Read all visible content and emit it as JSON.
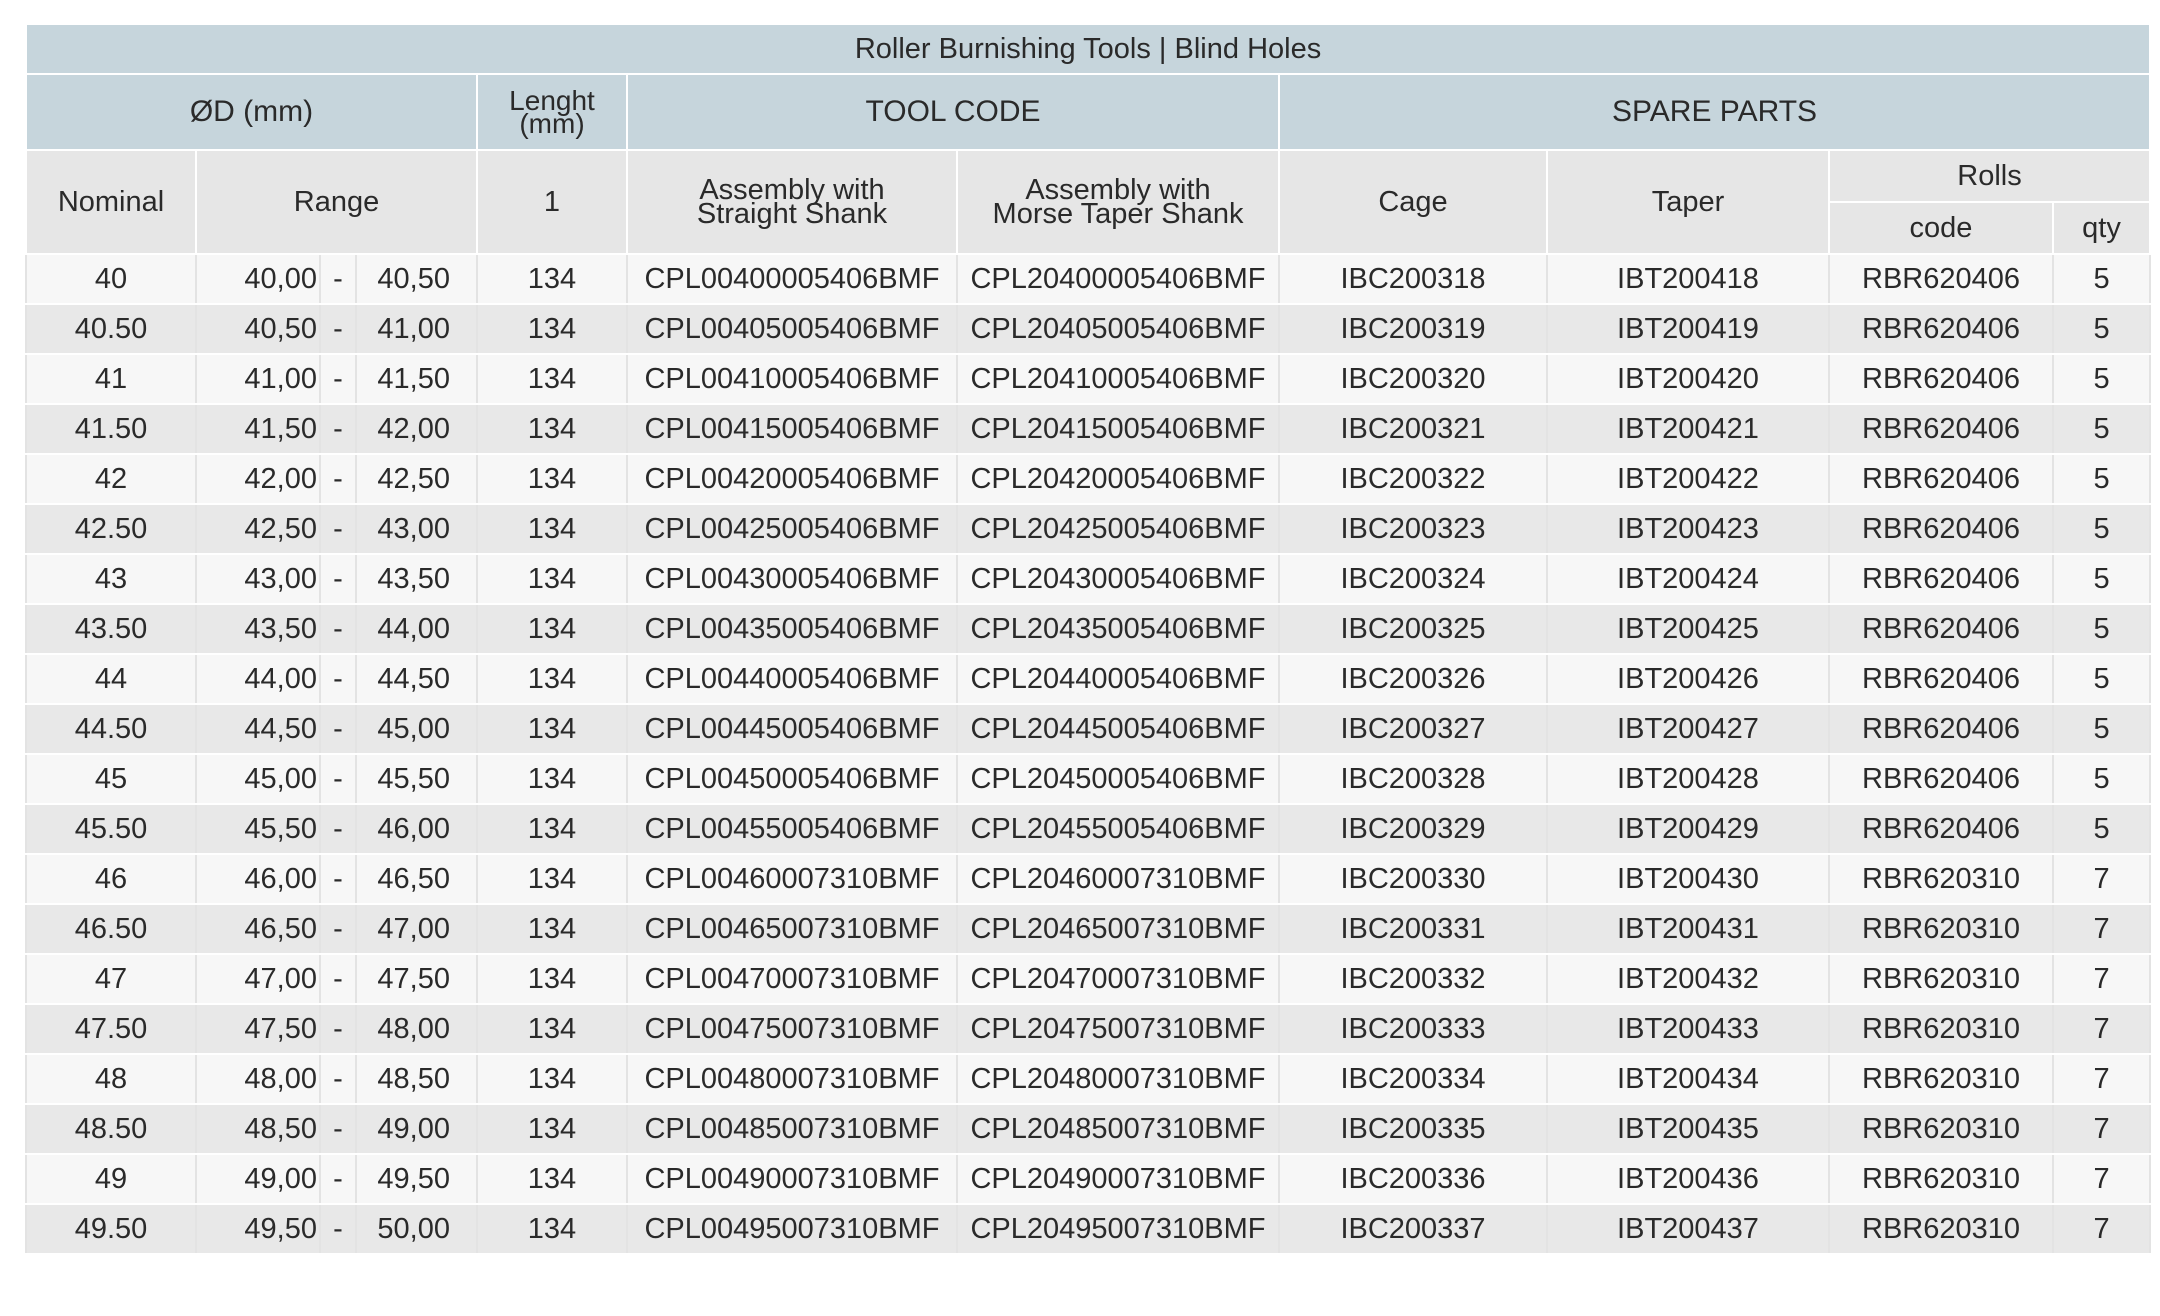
{
  "title": "Roller Burnishing Tools | Blind Holes",
  "header": {
    "diameter": "ØD (mm)",
    "length_line1": "Lenght",
    "length_line2": "(mm)",
    "tool_code": "TOOL CODE",
    "spare_parts": "SPARE PARTS",
    "nominal": "Nominal",
    "range": "Range",
    "length_value": "1",
    "straight_line1": "Assembly with",
    "straight_line2": "Straight Shank",
    "morse_line1": "Assembly with",
    "morse_line2": "Morse Taper Shank",
    "cage": "Cage",
    "taper": "Taper",
    "rolls": "Rolls",
    "rolls_code": "code",
    "rolls_qty": "qty"
  },
  "rows": [
    {
      "nominal": "40",
      "range_min": "40,00",
      "dash": "-",
      "range_max": "40,50",
      "length": "134",
      "straight": "CPL00400005406BMF",
      "morse": "CPL20400005406BMF",
      "cage": "IBC200318",
      "taper": "IBT200418",
      "roll_code": "RBR620406",
      "roll_qty": "5"
    },
    {
      "nominal": "40.50",
      "range_min": "40,50",
      "dash": "-",
      "range_max": "41,00",
      "length": "134",
      "straight": "CPL00405005406BMF",
      "morse": "CPL20405005406BMF",
      "cage": "IBC200319",
      "taper": "IBT200419",
      "roll_code": "RBR620406",
      "roll_qty": "5"
    },
    {
      "nominal": "41",
      "range_min": "41,00",
      "dash": "-",
      "range_max": "41,50",
      "length": "134",
      "straight": "CPL00410005406BMF",
      "morse": "CPL20410005406BMF",
      "cage": "IBC200320",
      "taper": "IBT200420",
      "roll_code": "RBR620406",
      "roll_qty": "5"
    },
    {
      "nominal": "41.50",
      "range_min": "41,50",
      "dash": "-",
      "range_max": "42,00",
      "length": "134",
      "straight": "CPL00415005406BMF",
      "morse": "CPL20415005406BMF",
      "cage": "IBC200321",
      "taper": "IBT200421",
      "roll_code": "RBR620406",
      "roll_qty": "5"
    },
    {
      "nominal": "42",
      "range_min": "42,00",
      "dash": "-",
      "range_max": "42,50",
      "length": "134",
      "straight": "CPL00420005406BMF",
      "morse": "CPL20420005406BMF",
      "cage": "IBC200322",
      "taper": "IBT200422",
      "roll_code": "RBR620406",
      "roll_qty": "5"
    },
    {
      "nominal": "42.50",
      "range_min": "42,50",
      "dash": "-",
      "range_max": "43,00",
      "length": "134",
      "straight": "CPL00425005406BMF",
      "morse": "CPL20425005406BMF",
      "cage": "IBC200323",
      "taper": "IBT200423",
      "roll_code": "RBR620406",
      "roll_qty": "5"
    },
    {
      "nominal": "43",
      "range_min": "43,00",
      "dash": "-",
      "range_max": "43,50",
      "length": "134",
      "straight": "CPL00430005406BMF",
      "morse": "CPL20430005406BMF",
      "cage": "IBC200324",
      "taper": "IBT200424",
      "roll_code": "RBR620406",
      "roll_qty": "5"
    },
    {
      "nominal": "43.50",
      "range_min": "43,50",
      "dash": "-",
      "range_max": "44,00",
      "length": "134",
      "straight": "CPL00435005406BMF",
      "morse": "CPL20435005406BMF",
      "cage": "IBC200325",
      "taper": "IBT200425",
      "roll_code": "RBR620406",
      "roll_qty": "5"
    },
    {
      "nominal": "44",
      "range_min": "44,00",
      "dash": "-",
      "range_max": "44,50",
      "length": "134",
      "straight": "CPL00440005406BMF",
      "morse": "CPL20440005406BMF",
      "cage": "IBC200326",
      "taper": "IBT200426",
      "roll_code": "RBR620406",
      "roll_qty": "5"
    },
    {
      "nominal": "44.50",
      "range_min": "44,50",
      "dash": "-",
      "range_max": "45,00",
      "length": "134",
      "straight": "CPL00445005406BMF",
      "morse": "CPL20445005406BMF",
      "cage": "IBC200327",
      "taper": "IBT200427",
      "roll_code": "RBR620406",
      "roll_qty": "5"
    },
    {
      "nominal": "45",
      "range_min": "45,00",
      "dash": "-",
      "range_max": "45,50",
      "length": "134",
      "straight": "CPL00450005406BMF",
      "morse": "CPL20450005406BMF",
      "cage": "IBC200328",
      "taper": "IBT200428",
      "roll_code": "RBR620406",
      "roll_qty": "5"
    },
    {
      "nominal": "45.50",
      "range_min": "45,50",
      "dash": "-",
      "range_max": "46,00",
      "length": "134",
      "straight": "CPL00455005406BMF",
      "morse": "CPL20455005406BMF",
      "cage": "IBC200329",
      "taper": "IBT200429",
      "roll_code": "RBR620406",
      "roll_qty": "5"
    },
    {
      "nominal": "46",
      "range_min": "46,00",
      "dash": "-",
      "range_max": "46,50",
      "length": "134",
      "straight": "CPL00460007310BMF",
      "morse": "CPL20460007310BMF",
      "cage": "IBC200330",
      "taper": "IBT200430",
      "roll_code": "RBR620310",
      "roll_qty": "7"
    },
    {
      "nominal": "46.50",
      "range_min": "46,50",
      "dash": "-",
      "range_max": "47,00",
      "length": "134",
      "straight": "CPL00465007310BMF",
      "morse": "CPL20465007310BMF",
      "cage": "IBC200331",
      "taper": "IBT200431",
      "roll_code": "RBR620310",
      "roll_qty": "7"
    },
    {
      "nominal": "47",
      "range_min": "47,00",
      "dash": "-",
      "range_max": "47,50",
      "length": "134",
      "straight": "CPL00470007310BMF",
      "morse": "CPL20470007310BMF",
      "cage": "IBC200332",
      "taper": "IBT200432",
      "roll_code": "RBR620310",
      "roll_qty": "7"
    },
    {
      "nominal": "47.50",
      "range_min": "47,50",
      "dash": "-",
      "range_max": "48,00",
      "length": "134",
      "straight": "CPL00475007310BMF",
      "morse": "CPL20475007310BMF",
      "cage": "IBC200333",
      "taper": "IBT200433",
      "roll_code": "RBR620310",
      "roll_qty": "7"
    },
    {
      "nominal": "48",
      "range_min": "48,00",
      "dash": "-",
      "range_max": "48,50",
      "length": "134",
      "straight": "CPL00480007310BMF",
      "morse": "CPL20480007310BMF",
      "cage": "IBC200334",
      "taper": "IBT200434",
      "roll_code": "RBR620310",
      "roll_qty": "7"
    },
    {
      "nominal": "48.50",
      "range_min": "48,50",
      "dash": "-",
      "range_max": "49,00",
      "length": "134",
      "straight": "CPL00485007310BMF",
      "morse": "CPL20485007310BMF",
      "cage": "IBC200335",
      "taper": "IBT200435",
      "roll_code": "RBR620310",
      "roll_qty": "7"
    },
    {
      "nominal": "49",
      "range_min": "49,00",
      "dash": "-",
      "range_max": "49,50",
      "length": "134",
      "straight": "CPL00490007310BMF",
      "morse": "CPL20490007310BMF",
      "cage": "IBC200336",
      "taper": "IBT200436",
      "roll_code": "RBR620310",
      "roll_qty": "7"
    },
    {
      "nominal": "49.50",
      "range_min": "49,50",
      "dash": "-",
      "range_max": "50,00",
      "length": "134",
      "straight": "CPL00495007310BMF",
      "morse": "CPL20495007310BMF",
      "cage": "IBC200337",
      "taper": "IBT200437",
      "roll_code": "RBR620310",
      "roll_qty": "7"
    }
  ],
  "colors": {
    "header_bg": "#c6d5dc",
    "subheader_bg": "#e6e6e6",
    "row_light": "#f7f7f7",
    "row_dark": "#e8e8e8",
    "text": "#2a2a2a"
  }
}
